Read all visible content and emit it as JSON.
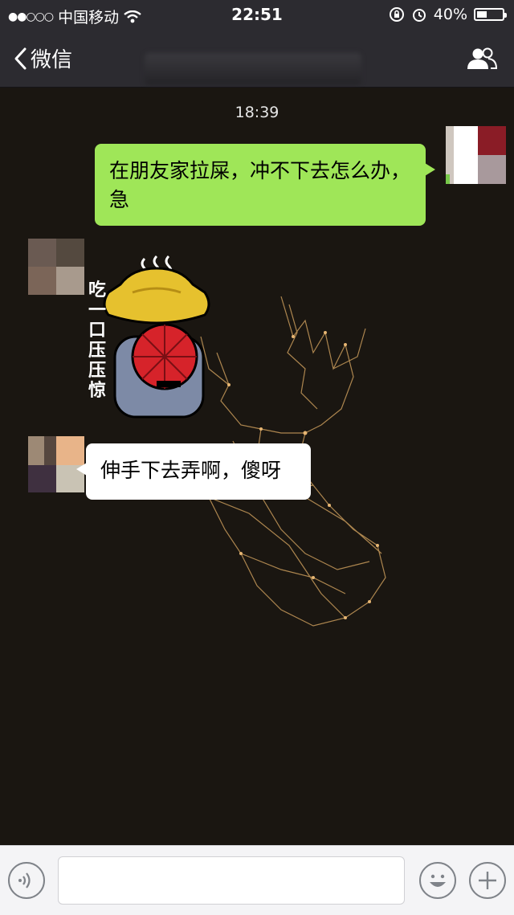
{
  "status_bar": {
    "carrier": "中国移动",
    "time": "22:51",
    "battery": "40%",
    "battery_level": 0.4
  },
  "nav": {
    "back_label": "微信"
  },
  "chat": {
    "timestamp": "18:39",
    "messages": [
      {
        "side": "out",
        "text": "在朋友家拉屎，冲不下去怎么办，急"
      },
      {
        "side": "in",
        "type": "sticker",
        "caption": "吃一口压压惊"
      },
      {
        "side": "in",
        "text": "伸手下去弄啊，傻呀"
      }
    ]
  },
  "colors": {
    "chat_background": "#1a1611",
    "outgoing_bubble": "#9fe658",
    "incoming_bubble": "#ffffff",
    "bar_background": "#2c2b30"
  },
  "icons": [
    "signal-dots-icon",
    "wifi-icon",
    "lock-rotation-icon",
    "alarm-icon",
    "battery-icon",
    "back-chevron-icon",
    "group-members-icon",
    "voice-icon",
    "emoji-icon",
    "plus-icon"
  ]
}
